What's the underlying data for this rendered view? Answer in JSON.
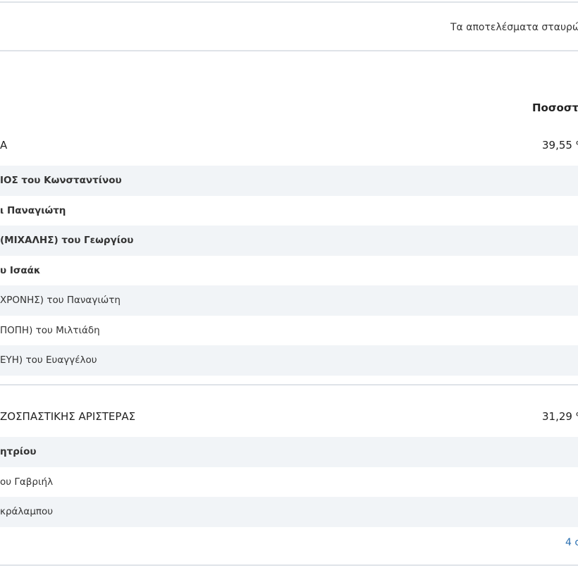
{
  "header": {
    "note": "Τα αποτελέσματα σταυρώ"
  },
  "table": {
    "col_header": "Ποσοστ"
  },
  "parties": [
    {
      "name": "Α",
      "pct": "39,55 %",
      "candidates": [
        "ΙΟΣ του Κωνσταντίνου",
        "ι Παναγιώτη",
        "(ΜΙΧΑΛΗΣ) του Γεωργίου",
        "υ Ισαάκ",
        "ΧΡΟΝΗΣ) του Παναγιώτη",
        "ΠΟΠΗ) του Μιλτιάδη",
        "ΕΥΗ) του Ευαγγέλου"
      ]
    },
    {
      "name": "ΖΟΣΠΑΣΤΙΚΗΣ ΑΡΙΣΤΕΡΑΣ",
      "pct": "31,29 %",
      "candidates": [
        "ητρίου",
        "ου Γαβριήλ",
        "κράλαμπου"
      ],
      "more_link": "4 c"
    }
  ]
}
